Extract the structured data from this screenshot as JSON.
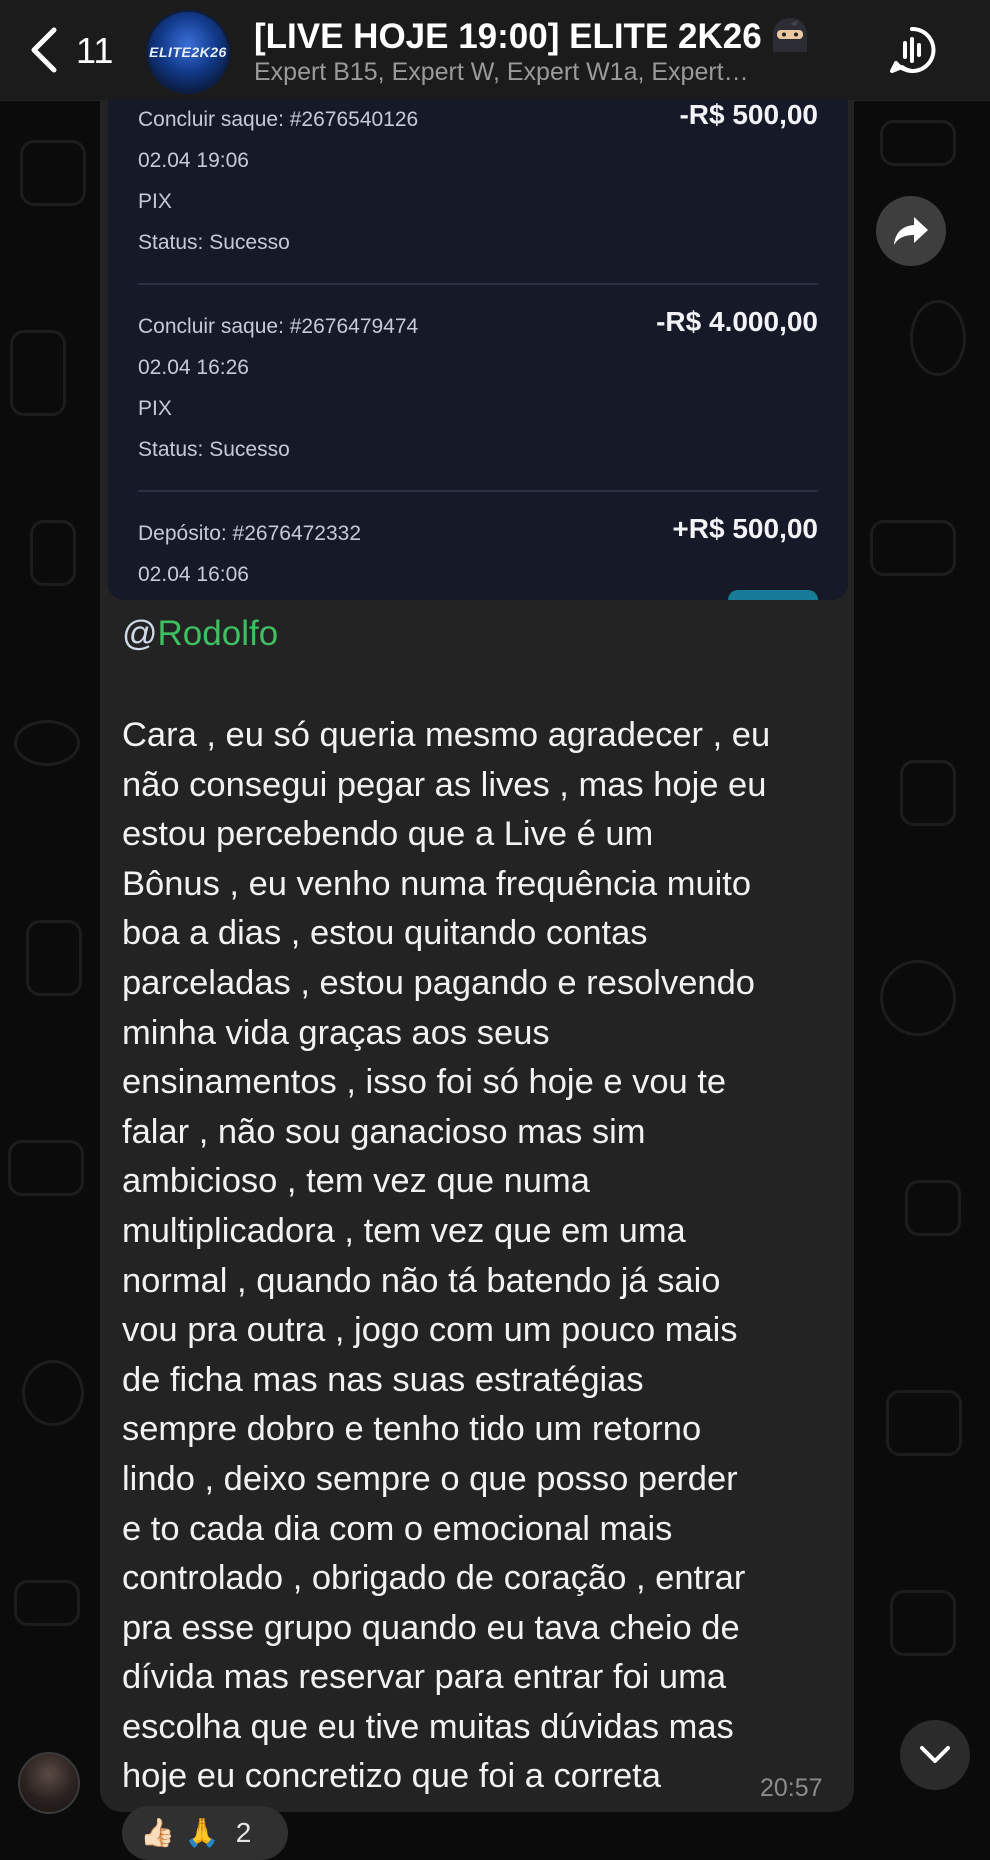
{
  "header": {
    "back_count": "11",
    "avatar_text": "ELITE2K26",
    "title": "[LIVE HOJE 19:00] ELITE 2K26",
    "title_emoji": "ninja",
    "subtitle": "Expert B15, Expert W, Expert W1a, Expert…"
  },
  "statement": {
    "transactions": [
      {
        "type": "Concluir saque: #2676540126",
        "datetime": "02.04 19:06",
        "method": "PIX",
        "status": "Status: Sucesso",
        "amount": "-R$ 500,00"
      },
      {
        "type": "Concluir saque: #2676479474",
        "datetime": "02.04 16:26",
        "method": "PIX",
        "status": "Status: Sucesso",
        "amount": "-R$ 4.000,00"
      },
      {
        "type": "Depósito: #2676472332",
        "datetime": "02.04 16:06",
        "amount": "+R$ 500,00"
      }
    ]
  },
  "message": {
    "mention_at": "@",
    "mention_name": "Rodolfo",
    "body": "Cara , eu só queria mesmo agradecer , eu\nnão consegui pegar as lives , mas hoje eu\nestou percebendo que a Live é um\nBônus , eu venho numa frequência muito\nboa a dias , estou quitando contas\nparceladas , estou pagando e resolvendo\nminha vida graças aos seus\nensinamentos , isso foi só hoje e vou te\nfalar , não sou ganacioso mas sim\nambicioso , tem vez que numa\nmultiplicadora , tem vez que em uma\nnormal , quando não tá batendo já saio\nvou pra outra , jogo com um pouco mais\nde ficha mas nas suas estratégias\nsempre dobro e tenho tido um retorno\nlindo , deixo sempre o que posso perder\ne to cada dia com o emocional mais\ncontrolado , obrigado de coração , entrar\npra esse grupo quando eu tava cheio de\ndívida mas reservar para entrar foi uma\nescolha que eu tive muitas dúvidas mas\nhoje eu concretizo que foi a correta",
    "time": "20:57"
  },
  "reactions": {
    "emojis": [
      "👍🏻",
      "🙏"
    ],
    "count": "2"
  },
  "colors": {
    "header_bg": "#1b1b1b",
    "bubble_bg": "#232323",
    "statement_bg": "#161a28",
    "mention_green": "#3fbf62"
  }
}
